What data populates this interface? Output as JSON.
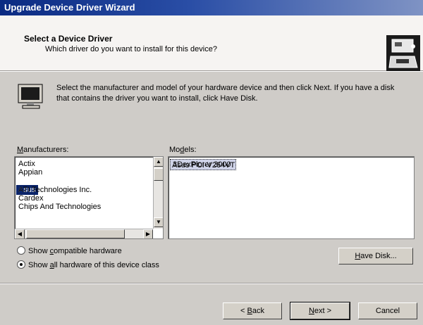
{
  "window": {
    "title": "Upgrade Device Driver Wizard"
  },
  "header": {
    "title": "Select a Device Driver",
    "subtitle": "Which driver do you want to install for this device?"
  },
  "instructions": "Select the manufacturer and model of your hardware device and then click Next. If you have a disk that contains the driver you want to install, click Have Disk.",
  "manufacturers": {
    "label_prefix": "",
    "label_accel": "M",
    "label_rest": "anufacturers:",
    "items": [
      "Actix",
      "Appian",
      "Asus",
      "ATI Technologies Inc.",
      "Cardex",
      "Chips And Technologies"
    ],
    "selected": "Asus"
  },
  "models": {
    "label_prefix": "Mo",
    "label_accel": "d",
    "label_rest": "els:",
    "items": [
      "3DexPlorer 3000",
      "Asus PCI-V264VT"
    ],
    "focused": "3DexPlorer 3000"
  },
  "radios": {
    "compatible": {
      "prefix": "Show ",
      "accel": "c",
      "rest": "ompatible hardware",
      "checked": false
    },
    "all": {
      "prefix": "Show ",
      "accel": "a",
      "rest": "ll hardware of this device class",
      "checked": true
    }
  },
  "buttons": {
    "have_disk": {
      "accel": "H",
      "rest": "ave Disk..."
    },
    "back": {
      "pre": "< ",
      "accel": "B",
      "rest": "ack"
    },
    "next": {
      "accel": "N",
      "rest": "ext >"
    },
    "cancel": "Cancel"
  }
}
